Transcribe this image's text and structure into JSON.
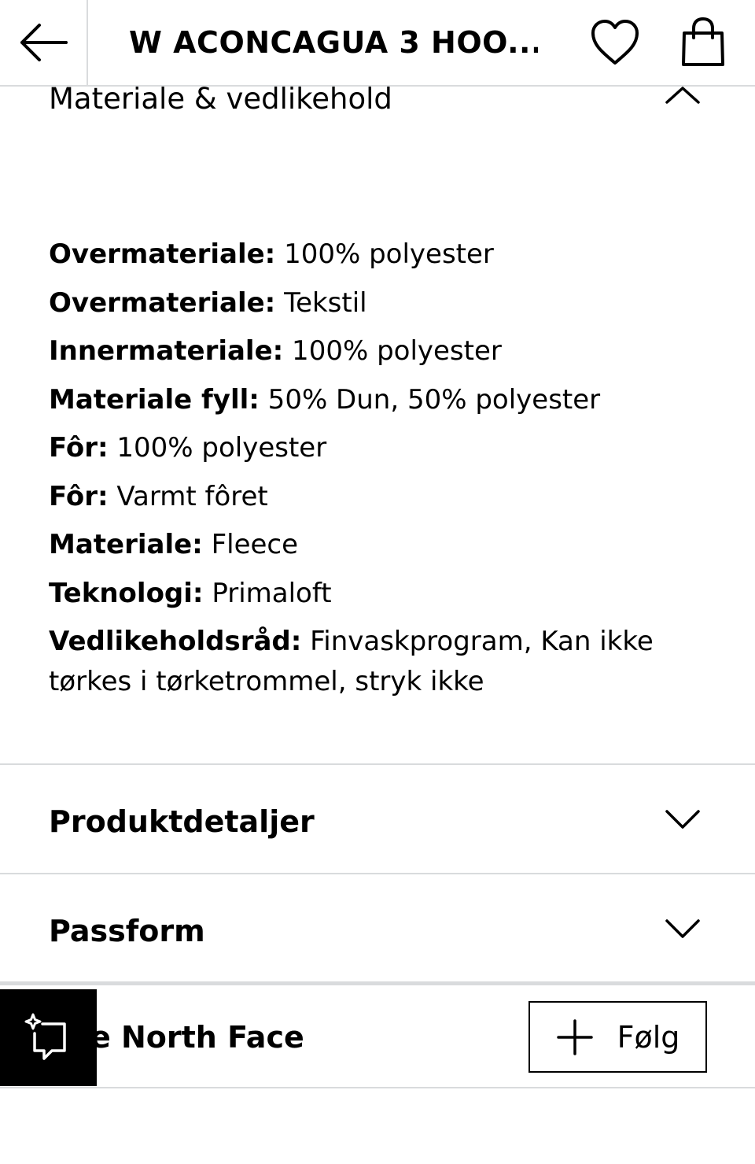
{
  "header": {
    "title": "W ACONCAGUA 3 HOO...",
    "back_icon": "arrow-left-icon",
    "wishlist_icon": "heart-icon",
    "bag_icon": "shopping-bag-icon"
  },
  "material_section": {
    "heading": "Materiale & vedlikehold",
    "expanded": true,
    "attributes": [
      {
        "label": "Overmateriale:",
        "value": " 100% polyester"
      },
      {
        "label": "Overmateriale:",
        "value": " Tekstil"
      },
      {
        "label": "Innermateriale:",
        "value": " 100% polyester"
      },
      {
        "label": "Materiale fyll:",
        "value": " 50% Dun, 50% polyester"
      },
      {
        "label": "Fôr:",
        "value": " 100% polyester"
      },
      {
        "label": "Fôr:",
        "value": " Varmt fôret"
      },
      {
        "label": "Materiale:",
        "value": " Fleece"
      },
      {
        "label": "Teknologi:",
        "value": " Primaloft"
      },
      {
        "label": "Vedlikeholdsråd:",
        "value": " Finvaskprogram, Kan ikke tørkes i tørketrommel, stryk ikke"
      }
    ]
  },
  "accordions": [
    {
      "label": "Produktdetaljer",
      "expanded": false
    },
    {
      "label": "Passform",
      "expanded": false
    }
  ],
  "brand": {
    "name": "The North Face",
    "follow_label": "Følg"
  },
  "colors": {
    "divider": "#d9dbdd",
    "text": "#000000",
    "background": "#ffffff"
  }
}
